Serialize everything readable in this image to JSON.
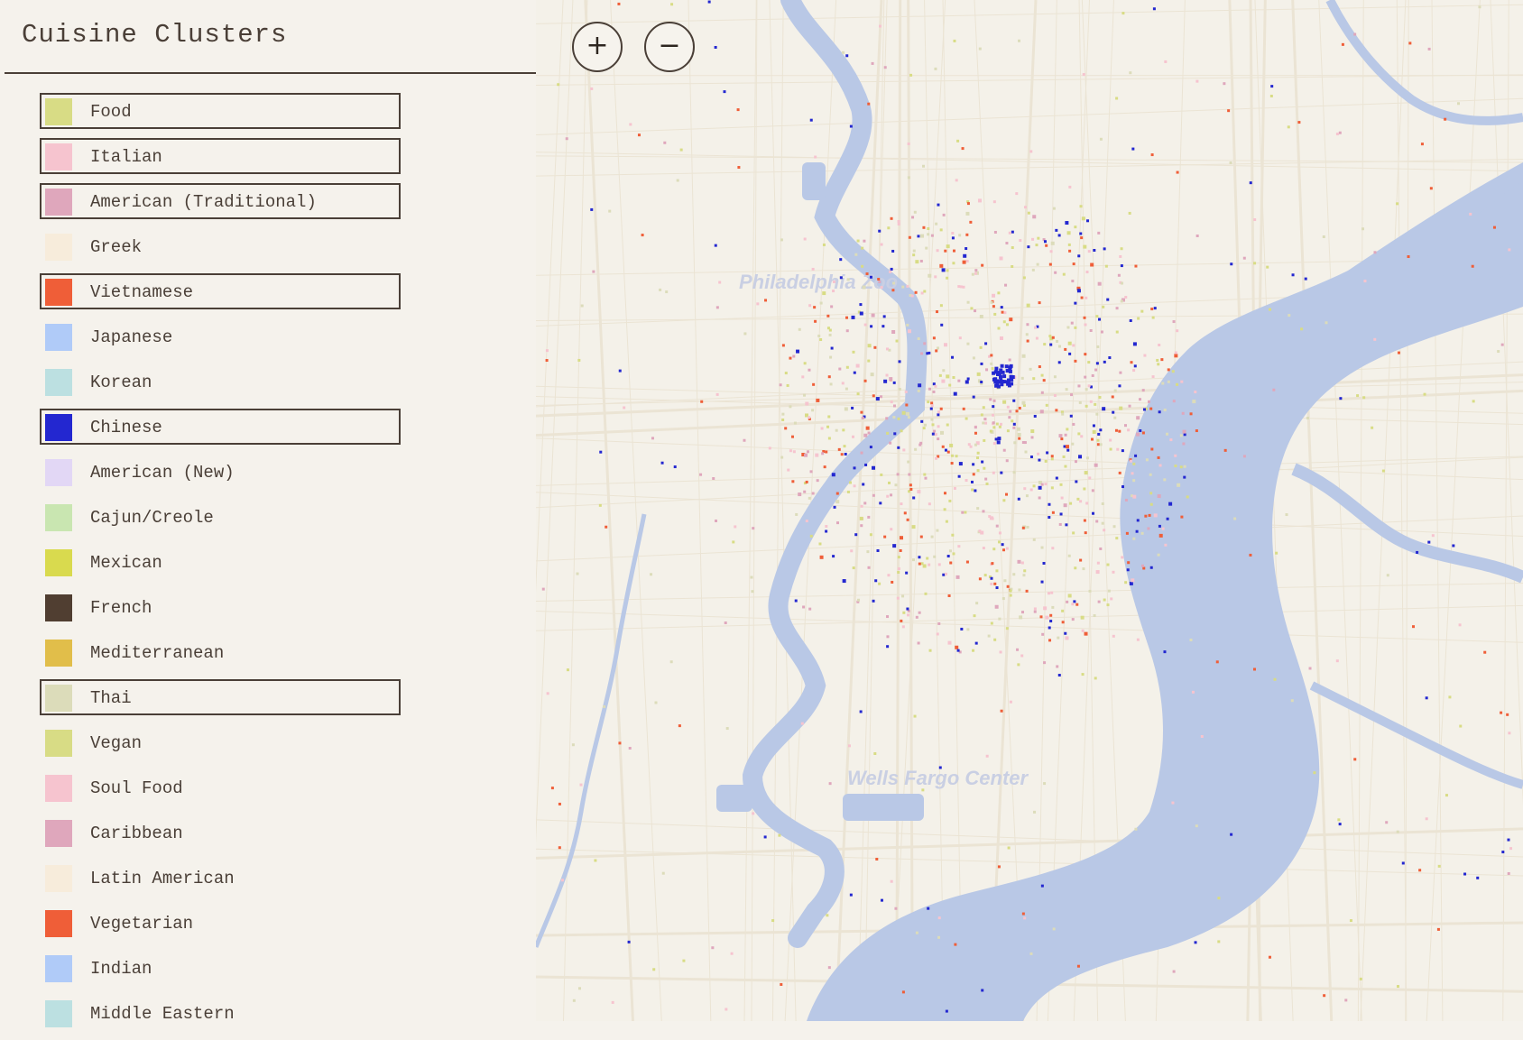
{
  "sidebar": {
    "title": "Cuisine Clusters",
    "legend": [
      {
        "label": "Food",
        "color": "#d8dc85",
        "selected": true
      },
      {
        "label": "Italian",
        "color": "#f6c4cf",
        "selected": true
      },
      {
        "label": "American (Traditional)",
        "color": "#dfa7bc",
        "selected": true
      },
      {
        "label": "Greek",
        "color": "#f7ecdb",
        "selected": false
      },
      {
        "label": "Vietnamese",
        "color": "#ef5e38",
        "selected": true
      },
      {
        "label": "Japanese",
        "color": "#b0cbf8",
        "selected": false
      },
      {
        "label": "Korean",
        "color": "#bce0e1",
        "selected": false
      },
      {
        "label": "Chinese",
        "color": "#2327d0",
        "selected": true
      },
      {
        "label": "American (New)",
        "color": "#e2d7f5",
        "selected": false
      },
      {
        "label": "Cajun/Creole",
        "color": "#c9e6b1",
        "selected": false
      },
      {
        "label": "Mexican",
        "color": "#d9da4e",
        "selected": false
      },
      {
        "label": "French",
        "color": "#503e31",
        "selected": false
      },
      {
        "label": "Mediterranean",
        "color": "#e1be4a",
        "selected": false
      },
      {
        "label": "Thai",
        "color": "#dcdcba",
        "selected": true
      },
      {
        "label": "Vegan",
        "color": "#d8dc85",
        "selected": false
      },
      {
        "label": "Soul Food",
        "color": "#f6c4cf",
        "selected": false
      },
      {
        "label": "Caribbean",
        "color": "#dfa7bc",
        "selected": false
      },
      {
        "label": "Latin American",
        "color": "#f7ecdb",
        "selected": false
      },
      {
        "label": "Vegetarian",
        "color": "#ef5e38",
        "selected": false
      },
      {
        "label": "Indian",
        "color": "#b0cbf8",
        "selected": false
      },
      {
        "label": "Middle Eastern",
        "color": "#bce0e1",
        "selected": false
      }
    ]
  },
  "map": {
    "zoom_in_label": "+",
    "zoom_out_label": "−",
    "zoom_in_icon": "plus-icon",
    "zoom_out_icon": "minus-icon",
    "place_labels": [
      "Philadelphia Zoo",
      "Wells Fargo Center"
    ],
    "colors": {
      "land": "#f4f1e9",
      "water": "#b9c8e6",
      "road": "#ebe4d4"
    }
  }
}
